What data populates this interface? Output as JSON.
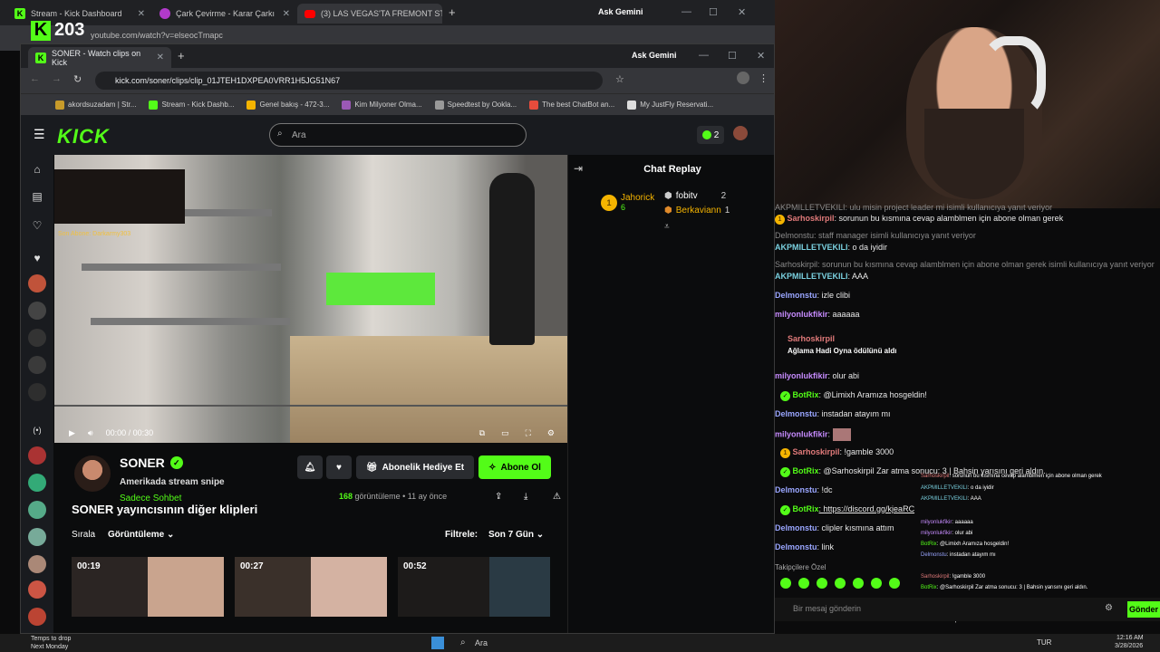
{
  "bg_browser": {
    "tabs": [
      {
        "title": "Stream - Kick Dashboard"
      },
      {
        "title": "Çark Çevirme - Karar Çarkı"
      },
      {
        "title": "(3) LAS VEGAS'TA FREMONT ST"
      }
    ],
    "ask": "Ask Gemini",
    "url": "youtube.com/watch?v=elseocTmapc",
    "counter": "203"
  },
  "fg_browser": {
    "tab_title": "SONER - Watch clips on Kick",
    "ask": "Ask Gemini",
    "url": "kick.com/soner/clips/clip_01JTEH1DXPEA0VRR1H5JG51N67",
    "bookmarks": [
      "akordsuzadam | Str...",
      "Stream - Kick Dashb...",
      "Genel bakış - 472-3...",
      "Kim Milyoner Olma...",
      "Speedtest by Ookla...",
      "The best ChatBot an...",
      "My JustFly Reservati..."
    ]
  },
  "kick": {
    "logo": "KICK",
    "search_placeholder": "Ara",
    "notif_count": "2",
    "video": {
      "overlay_text": "Son Abone: Darkarmy303",
      "time": "00:00 / 00:30"
    },
    "chat": {
      "title": "Chat Replay",
      "leaders": [
        {
          "rank": "1",
          "name": "Jahorick",
          "count": "6"
        },
        {
          "name": "fobitv",
          "count": "2"
        },
        {
          "name": "Berkaviann",
          "count": "1"
        }
      ]
    },
    "streamer": {
      "name": "SONER",
      "clip_title": "Amerikada stream snipe",
      "category": "Sadece Sohbet",
      "views": "168",
      "views_label": "görüntüleme",
      "ago": "• 11 ay önce"
    },
    "buttons": {
      "gift": "Abonelik Hediye Et",
      "subscribe": "Abone Ol"
    },
    "clips": {
      "heading": "SONER yayıncısının diğer klipleri",
      "sort_label": "Sırala",
      "sort_value": "Görüntüleme",
      "filter_label": "Filtrele:",
      "filter_value": "Son 7 Gün",
      "durations": [
        "00:19",
        "00:27",
        "00:52"
      ]
    }
  },
  "stream_chat": [
    {
      "user": "",
      "text": "AKPMILLETVEKILI: ulu misin project leader mi isimli kullanıcıya yanıt veriyor",
      "sys": true
    },
    {
      "user": "Sarhoskirpil",
      "text": ": sorunun bu kısmına cevap alamblmen için abone olman gerek"
    },
    {
      "user": "",
      "text": "Delmonstu: staff manager isimli kullanıcıya yanıt veriyor",
      "sys": true
    },
    {
      "user": "AKPMILLETVEKILI",
      "text": ": o da iyidir"
    },
    {
      "user": "",
      "text": "Sarhoskirpil: sorunun bu kısmına cevap alamblmen için abone olman gerek isimli kullanıcıya yanıt veriyor",
      "sys": true
    },
    {
      "user": "AKPMILLETVEKILI",
      "text": ": AAA"
    },
    {
      "user": "Delmonstu",
      "text": ": izle clibi"
    },
    {
      "user": "milyonlukfikir",
      "text": ": aaaaaa"
    },
    {
      "user": "Sarhoskirpil",
      "text": ""
    },
    {
      "user": "",
      "text": "Ağlama Hadi Oyna ödülünü aldı"
    },
    {
      "user": "milyonlukfikir",
      "text": ": olur abi"
    },
    {
      "user": "BotRix",
      "text": ": @Limixh Aramıza hosgeldin!"
    },
    {
      "user": "Delmonstu",
      "text": ": instadan atayım mı"
    },
    {
      "user": "milyonlukfikir",
      "text": ":"
    },
    {
      "user": "Sarhoskirpil",
      "text": ": !gamble 3000"
    },
    {
      "user": "BotRix",
      "text": ": @Sarhoskirpil Zar atma sonucu: 3 | Bahsin yarısını geri aldın."
    },
    {
      "user": "Delmonstu",
      "text": ": !dc"
    },
    {
      "user": "BotRix",
      "text": ": https://discord.gg/kjeaRC"
    },
    {
      "user": "Delmonstu",
      "text": ": clipler kısmına attım"
    },
    {
      "user": "Delmonstu",
      "text": ": link"
    }
  ],
  "stream_ui": {
    "followers_only": "Takipçilere Özel",
    "send_placeholder": "Bir mesaj gönderin",
    "send": "Gönder"
  },
  "taskbar": {
    "weather": "Temps to drop",
    "weather2": "Next Monday",
    "search": "Ara",
    "lang": "TUR",
    "time": "12:16 AM",
    "date": "3/28/2026"
  },
  "colors": {
    "kick_green": "#53fc18",
    "bg": "#0b0c0d",
    "chrome_dark": "#202124",
    "chrome_mid": "#35363a"
  }
}
